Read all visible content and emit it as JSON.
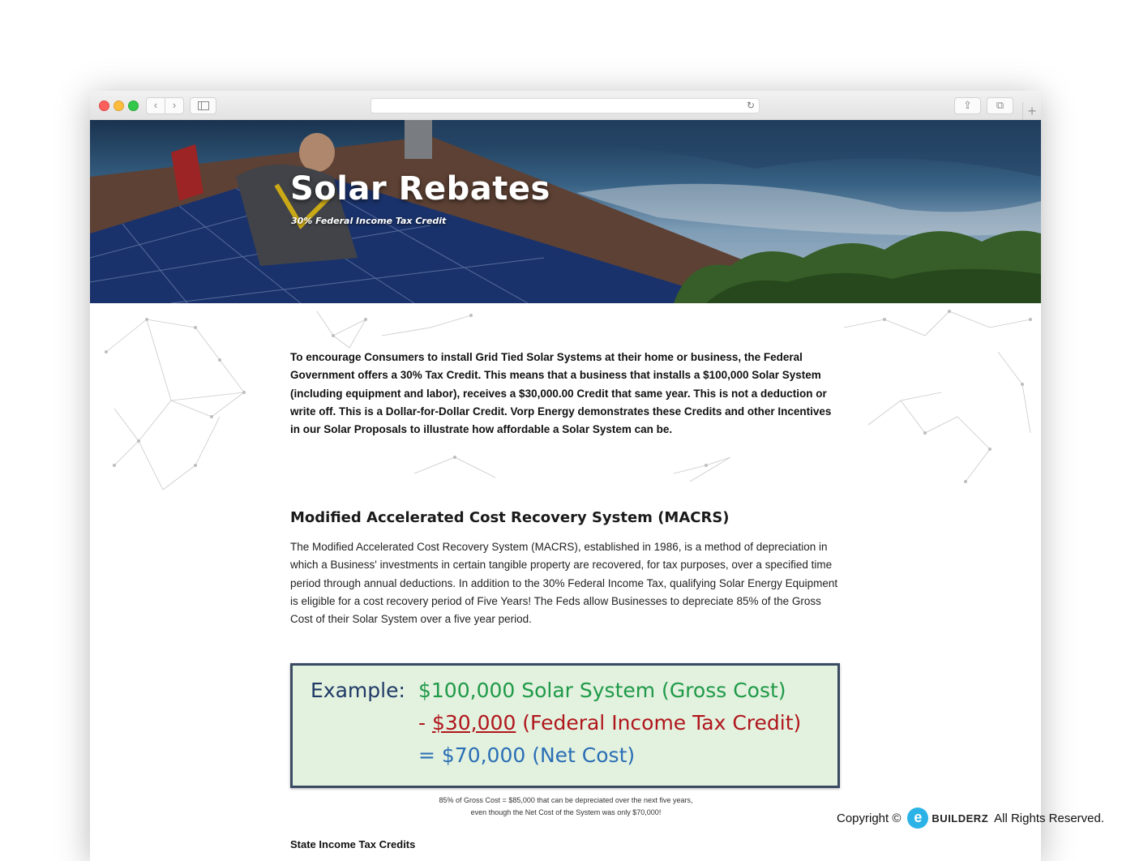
{
  "browser": {
    "back_icon": "‹",
    "forward_icon": "›",
    "reload_icon": "↻",
    "share_icon": "⇪",
    "tabs_icon": "⧉",
    "newtab_icon": "+"
  },
  "hero": {
    "title": "Solar Rebates",
    "subtitle": "30% Federal Income Tax Credit"
  },
  "intro": {
    "text": "To encourage Consumers to install Grid Tied Solar Systems at their home or business, the Federal Government offers a 30% Tax Credit. This means that a business that installs a $100,000 Solar System (including equipment and labor), receives a $30,000.00 Credit that same year. This is not a deduction or write off. This is a Dollar-for-Dollar Credit. Vorp Energy demonstrates these Credits and other Incentives in our Solar Proposals to illustrate how affordable a Solar System can be."
  },
  "macrs": {
    "heading": "Modified Accelerated Cost Recovery System (MACRS)",
    "body": "The Modified Accelerated Cost Recovery System (MACRS), established in 1986, is a method of depreciation in which a Business' investments in certain tangible property are recovered, for tax purposes, over a specified time period through annual deductions. In addition to the 30% Federal Income Tax, qualifying Solar Energy Equipment is eligible for a cost recovery period of Five Years! The Feds allow Businesses to depreciate 85% of the Gross Cost of their Solar System over a five year period."
  },
  "example": {
    "label": "Example:",
    "line1": "$100,000 Solar System (Gross Cost)",
    "line2_prefix": "- ",
    "line2_amount": "$30,000",
    "line2_suffix": " (Federal Income Tax Credit)",
    "line3": "= $70,000 (Net Cost)",
    "colors": {
      "label": "#1f3a66",
      "gross": "#1e9a48",
      "credit": "#b0161c",
      "net": "#2a6fb5",
      "background": "#e3f1df"
    }
  },
  "caption": {
    "line1": "85% of Gross Cost = $85,000 that can be depreciated over the next five years,",
    "line2": "even though the Net Cost of the System was only $70,000!"
  },
  "state": {
    "heading": "State Income Tax Credits"
  },
  "footer": {
    "copyright": "Copyright ©",
    "logo_letter": "e",
    "logo_text": "BUILDERZ",
    "rights": "All Rights Reserved."
  }
}
